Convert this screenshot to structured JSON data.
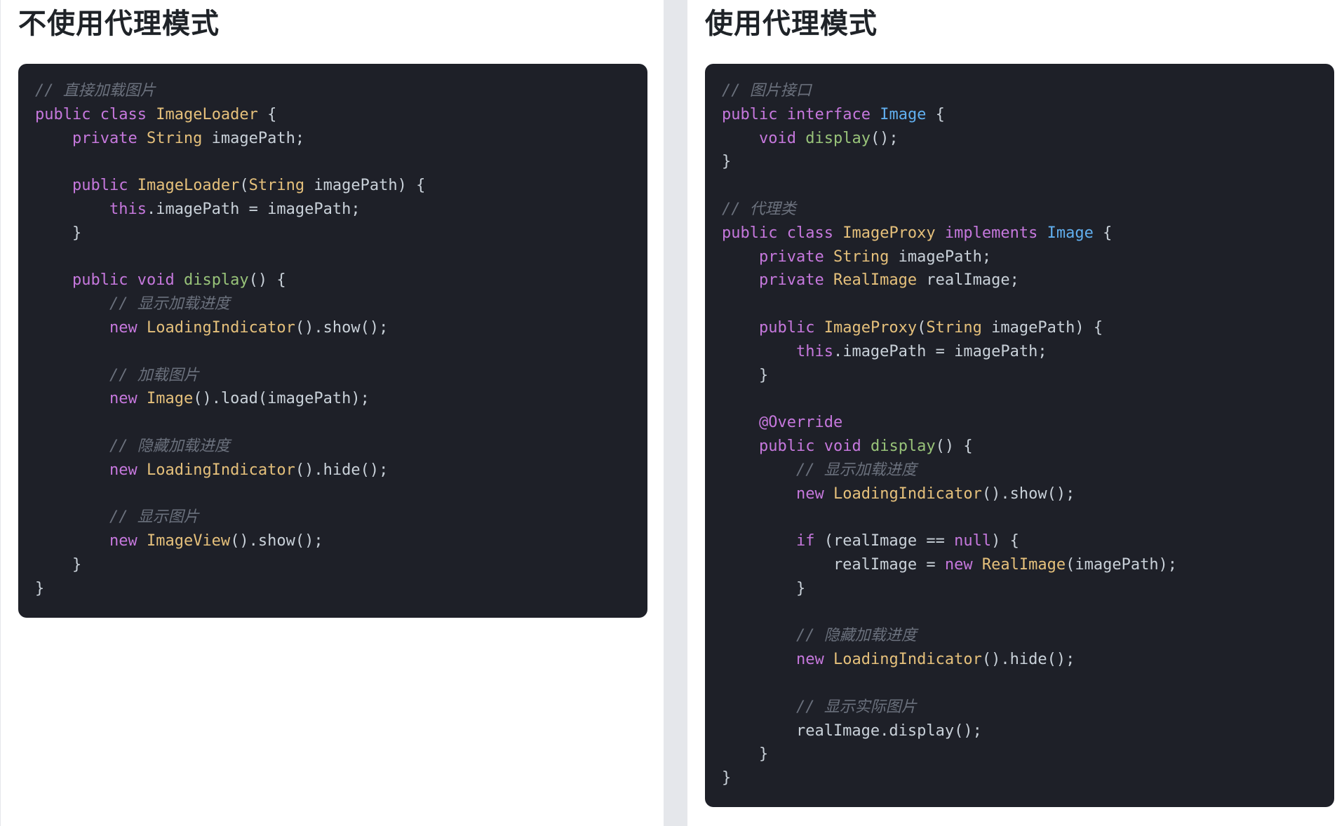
{
  "colors": {
    "page_background": "#ffffff",
    "divider": "#e5e7eb",
    "code_background": "#1e2028",
    "keyword": "#c678dd",
    "type_name": "#e5c07b",
    "interface_name": "#61afef",
    "function_name": "#98c379",
    "comment": "#6b717d",
    "plain": "#c9d1d9",
    "heading": "#1f2328"
  },
  "panels": [
    {
      "title": "不使用代理模式",
      "code_lines": [
        [
          [
            "cm",
            "// 直接加载图片"
          ]
        ],
        [
          [
            "kw",
            "public"
          ],
          [
            "pl",
            " "
          ],
          [
            "kw",
            "class"
          ],
          [
            "pl",
            " "
          ],
          [
            "ty",
            "ImageLoader"
          ],
          [
            "pl",
            " {"
          ]
        ],
        [
          [
            "pl",
            "    "
          ],
          [
            "kw",
            "private"
          ],
          [
            "pl",
            " "
          ],
          [
            "ty",
            "String"
          ],
          [
            "pl",
            " imagePath;"
          ]
        ],
        [],
        [
          [
            "pl",
            "    "
          ],
          [
            "kw",
            "public"
          ],
          [
            "pl",
            " "
          ],
          [
            "ty",
            "ImageLoader"
          ],
          [
            "pl",
            "("
          ],
          [
            "ty",
            "String"
          ],
          [
            "pl",
            " imagePath) {"
          ]
        ],
        [
          [
            "pl",
            "        "
          ],
          [
            "kw",
            "this"
          ],
          [
            "pl",
            ".imagePath = imagePath;"
          ]
        ],
        [
          [
            "pl",
            "    }"
          ]
        ],
        [],
        [
          [
            "pl",
            "    "
          ],
          [
            "kw",
            "public"
          ],
          [
            "pl",
            " "
          ],
          [
            "kw",
            "void"
          ],
          [
            "pl",
            " "
          ],
          [
            "fn",
            "display"
          ],
          [
            "pl",
            "() {"
          ]
        ],
        [
          [
            "pl",
            "        "
          ],
          [
            "cm",
            "// 显示加载进度"
          ]
        ],
        [
          [
            "pl",
            "        "
          ],
          [
            "kw",
            "new"
          ],
          [
            "pl",
            " "
          ],
          [
            "ty",
            "LoadingIndicator"
          ],
          [
            "pl",
            "().show();"
          ]
        ],
        [],
        [
          [
            "pl",
            "        "
          ],
          [
            "cm",
            "// 加载图片"
          ]
        ],
        [
          [
            "pl",
            "        "
          ],
          [
            "kw",
            "new"
          ],
          [
            "pl",
            " "
          ],
          [
            "ty",
            "Image"
          ],
          [
            "pl",
            "().load(imagePath);"
          ]
        ],
        [],
        [
          [
            "pl",
            "        "
          ],
          [
            "cm",
            "// 隐藏加载进度"
          ]
        ],
        [
          [
            "pl",
            "        "
          ],
          [
            "kw",
            "new"
          ],
          [
            "pl",
            " "
          ],
          [
            "ty",
            "LoadingIndicator"
          ],
          [
            "pl",
            "().hide();"
          ]
        ],
        [],
        [
          [
            "pl",
            "        "
          ],
          [
            "cm",
            "// 显示图片"
          ]
        ],
        [
          [
            "pl",
            "        "
          ],
          [
            "kw",
            "new"
          ],
          [
            "pl",
            " "
          ],
          [
            "ty",
            "ImageView"
          ],
          [
            "pl",
            "().show();"
          ]
        ],
        [
          [
            "pl",
            "    }"
          ]
        ],
        [
          [
            "pl",
            "}"
          ]
        ]
      ]
    },
    {
      "title": "使用代理模式",
      "code_lines": [
        [
          [
            "cm",
            "// 图片接口"
          ]
        ],
        [
          [
            "kw",
            "public"
          ],
          [
            "pl",
            " "
          ],
          [
            "kw",
            "interface"
          ],
          [
            "pl",
            " "
          ],
          [
            "if",
            "Image"
          ],
          [
            "pl",
            " {"
          ]
        ],
        [
          [
            "pl",
            "    "
          ],
          [
            "kw",
            "void"
          ],
          [
            "pl",
            " "
          ],
          [
            "fn",
            "display"
          ],
          [
            "pl",
            "();"
          ]
        ],
        [
          [
            "pl",
            "}"
          ]
        ],
        [],
        [
          [
            "cm",
            "// 代理类"
          ]
        ],
        [
          [
            "kw",
            "public"
          ],
          [
            "pl",
            " "
          ],
          [
            "kw",
            "class"
          ],
          [
            "pl",
            " "
          ],
          [
            "ty",
            "ImageProxy"
          ],
          [
            "pl",
            " "
          ],
          [
            "kw",
            "implements"
          ],
          [
            "pl",
            " "
          ],
          [
            "if",
            "Image"
          ],
          [
            "pl",
            " {"
          ]
        ],
        [
          [
            "pl",
            "    "
          ],
          [
            "kw",
            "private"
          ],
          [
            "pl",
            " "
          ],
          [
            "ty",
            "String"
          ],
          [
            "pl",
            " imagePath;"
          ]
        ],
        [
          [
            "pl",
            "    "
          ],
          [
            "kw",
            "private"
          ],
          [
            "pl",
            " "
          ],
          [
            "ty",
            "RealImage"
          ],
          [
            "pl",
            " realImage;"
          ]
        ],
        [],
        [
          [
            "pl",
            "    "
          ],
          [
            "kw",
            "public"
          ],
          [
            "pl",
            " "
          ],
          [
            "ty",
            "ImageProxy"
          ],
          [
            "pl",
            "("
          ],
          [
            "ty",
            "String"
          ],
          [
            "pl",
            " imagePath) {"
          ]
        ],
        [
          [
            "pl",
            "        "
          ],
          [
            "kw",
            "this"
          ],
          [
            "pl",
            ".imagePath = imagePath;"
          ]
        ],
        [
          [
            "pl",
            "    }"
          ]
        ],
        [],
        [
          [
            "pl",
            "    "
          ],
          [
            "kw",
            "@Override"
          ]
        ],
        [
          [
            "pl",
            "    "
          ],
          [
            "kw",
            "public"
          ],
          [
            "pl",
            " "
          ],
          [
            "kw",
            "void"
          ],
          [
            "pl",
            " "
          ],
          [
            "fn",
            "display"
          ],
          [
            "pl",
            "() {"
          ]
        ],
        [
          [
            "pl",
            "        "
          ],
          [
            "cm",
            "// 显示加载进度"
          ]
        ],
        [
          [
            "pl",
            "        "
          ],
          [
            "kw",
            "new"
          ],
          [
            "pl",
            " "
          ],
          [
            "ty",
            "LoadingIndicator"
          ],
          [
            "pl",
            "().show();"
          ]
        ],
        [],
        [
          [
            "pl",
            "        "
          ],
          [
            "kw",
            "if"
          ],
          [
            "pl",
            " (realImage == "
          ],
          [
            "kw",
            "null"
          ],
          [
            "pl",
            ") {"
          ]
        ],
        [
          [
            "pl",
            "            realImage = "
          ],
          [
            "kw",
            "new"
          ],
          [
            "pl",
            " "
          ],
          [
            "ty",
            "RealImage"
          ],
          [
            "pl",
            "(imagePath);"
          ]
        ],
        [
          [
            "pl",
            "        }"
          ]
        ],
        [],
        [
          [
            "pl",
            "        "
          ],
          [
            "cm",
            "// 隐藏加载进度"
          ]
        ],
        [
          [
            "pl",
            "        "
          ],
          [
            "kw",
            "new"
          ],
          [
            "pl",
            " "
          ],
          [
            "ty",
            "LoadingIndicator"
          ],
          [
            "pl",
            "().hide();"
          ]
        ],
        [],
        [
          [
            "pl",
            "        "
          ],
          [
            "cm",
            "// 显示实际图片"
          ]
        ],
        [
          [
            "pl",
            "        realImage.display();"
          ]
        ],
        [
          [
            "pl",
            "    }"
          ]
        ],
        [
          [
            "pl",
            "}"
          ]
        ]
      ]
    }
  ]
}
